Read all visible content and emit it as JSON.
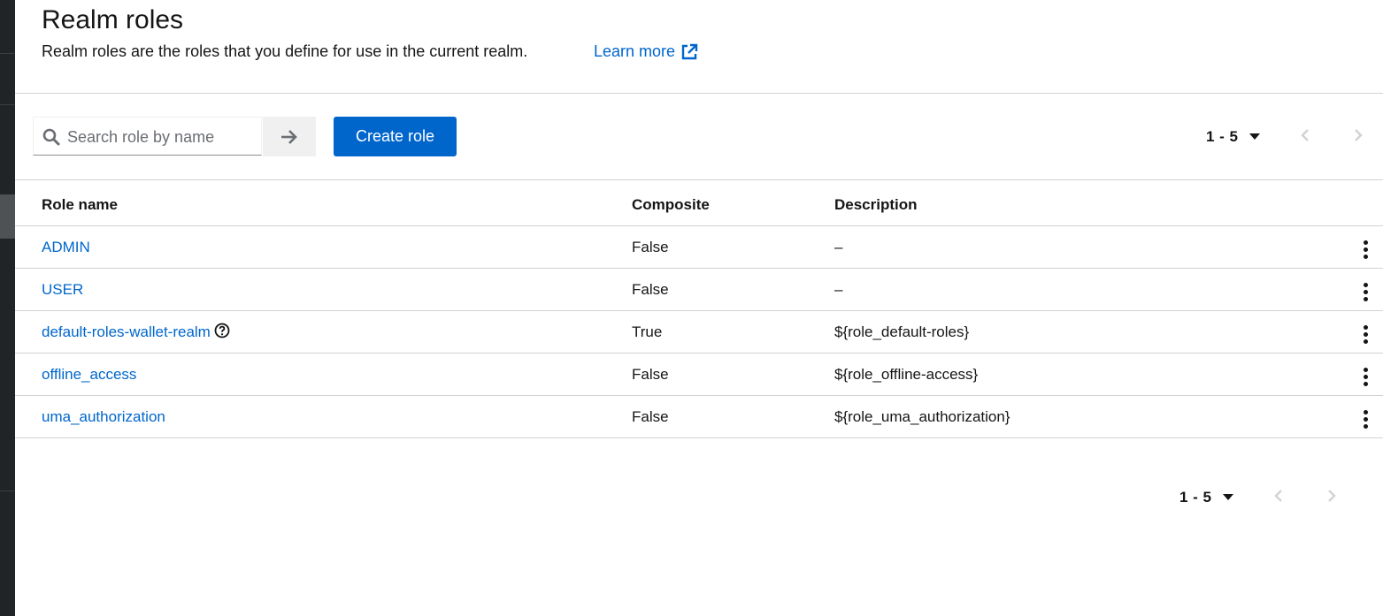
{
  "header": {
    "title": "Realm roles",
    "description": "Realm roles are the roles that you define for use in the current realm.",
    "learn_more": "Learn more"
  },
  "toolbar": {
    "search_placeholder": "Search role by name",
    "create_button": "Create role"
  },
  "pagination": {
    "range": "1 - 5"
  },
  "table": {
    "columns": [
      "Role name",
      "Composite",
      "Description"
    ],
    "rows": [
      {
        "name": "ADMIN",
        "composite": "False",
        "description": "–"
      },
      {
        "name": "USER",
        "composite": "False",
        "description": "–"
      },
      {
        "name": "default-roles-wallet-realm",
        "composite": "True",
        "description": "${role_default-roles}"
      },
      {
        "name": "offline_access",
        "composite": "False",
        "description": "${role_offline-access}"
      },
      {
        "name": "uma_authorization",
        "composite": "False",
        "description": "${role_uma_authorization}"
      }
    ]
  },
  "colors": {
    "link": "#0066cc",
    "primary_button": "#0066cc",
    "sidebar": "#212427"
  }
}
